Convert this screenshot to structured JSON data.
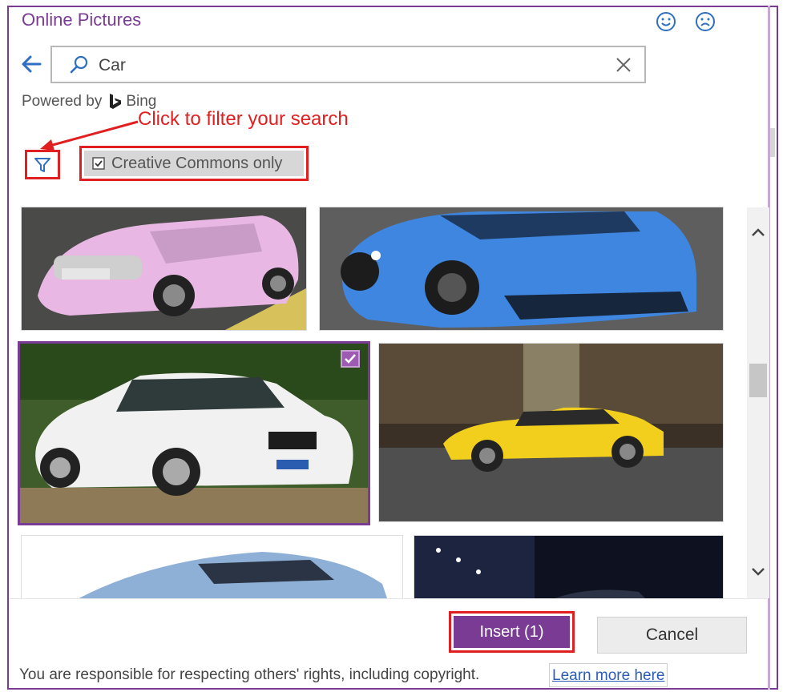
{
  "dialog": {
    "title": "Online Pictures",
    "accent_color": "#7a3b95",
    "annotation_color": "#e02020",
    "feedback": {
      "smile_icon": "smiley-icon",
      "frown_icon": "frowny-icon"
    }
  },
  "search": {
    "back_icon": "back-arrow-icon",
    "search_icon": "search-icon",
    "query": "Car",
    "clear_icon": "close-icon"
  },
  "powered_by": {
    "label": "Powered by",
    "logo_icon": "bing-logo-icon",
    "brand": "Bing"
  },
  "annotation": {
    "text": "Click to filter your search"
  },
  "filters": {
    "filter_icon": "funnel-icon",
    "creative_commons_label": "Creative Commons only",
    "creative_commons_checked": true
  },
  "results": {
    "items": [
      {
        "subject": "pink smart car",
        "selected": false
      },
      {
        "subject": "blue sports car",
        "selected": false
      },
      {
        "subject": "white sedan",
        "selected": true
      },
      {
        "subject": "yellow sports car",
        "selected": false
      },
      {
        "subject": "silver concept car",
        "selected": false
      },
      {
        "subject": "car at night",
        "selected": false
      }
    ]
  },
  "footer": {
    "insert_label": "Insert (1)",
    "cancel_label": "Cancel",
    "disclaimer": "You are responsible for respecting others' rights, including copyright.",
    "learn_more": "Learn more here"
  }
}
